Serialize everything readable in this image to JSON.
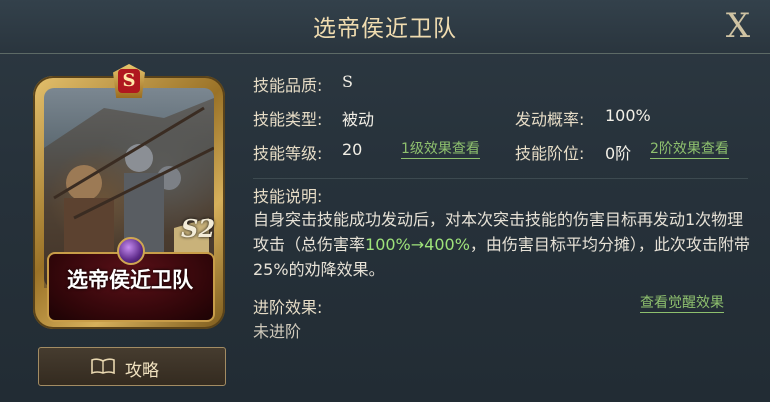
{
  "header": {
    "title": "选帝侯近卫队",
    "close_label": "X"
  },
  "card": {
    "rank_badge": "S",
    "name": "选帝侯近卫队",
    "grade": "S2"
  },
  "guide_button": {
    "label": "攻略"
  },
  "info": {
    "quality_label": "技能品质:",
    "quality_value": "S",
    "type_label": "技能类型:",
    "type_value": "被动",
    "rate_label": "发动概率:",
    "rate_value": "100%",
    "level_label": "技能等级:",
    "level_value": "20",
    "level_link": "1级效果查看",
    "tier_label": "技能阶位:",
    "tier_value": "0阶",
    "tier_link": "2阶效果查看"
  },
  "description": {
    "label": "技能说明:",
    "text_before": "自身突击技能成功发动后，对本次突击技能的伤害目标再发动1次物理攻击（总伤害率",
    "highlight": "100%→400%",
    "text_after": "，由伤害目标平均分摊），此次攻击附带25%的劝降效果。"
  },
  "advance": {
    "label": "进阶效果:",
    "link": "查看觉醒效果",
    "value": "未进阶"
  },
  "colors": {
    "highlight": "#9ee27a",
    "link": "#8ec06e",
    "title": "#f0dcb0"
  }
}
